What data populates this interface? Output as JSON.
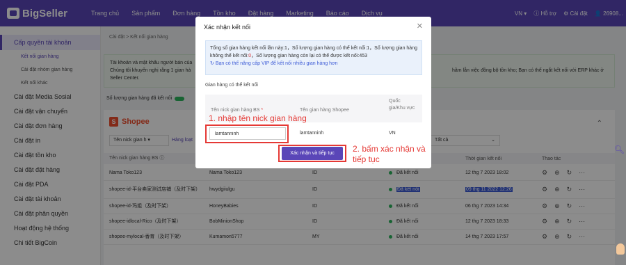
{
  "header": {
    "logo": "BigSeller",
    "nav": [
      "Trang chủ",
      "Sản phẩm",
      "Đơn hàng",
      "Tồn kho",
      "Đặt hàng",
      "Marketing",
      "Báo cáo",
      "Dịch vụ"
    ],
    "region": "VN",
    "help": "Hỗ trợ",
    "settings": "Cài đặt",
    "user": "26908..."
  },
  "sidebar": {
    "active": "Cấp quyền tài khoản",
    "subs": [
      "Kết nối gian hàng",
      "Cài đặt nhóm gian hàng",
      "Kết nối khác"
    ],
    "items": [
      "Cài đặt Media Sosial",
      "Cài đặt vận chuyển",
      "Cài đặt đơn hàng",
      "Cài đặt in",
      "Cài đặt tồn kho",
      "Cài đặt đặt hàng",
      "Cài đặt PDA",
      "Cài đặt tài khoản",
      "Cài đặt phân quyền",
      "Hoạt động hệ thống",
      "Chi tiết BigCoin"
    ]
  },
  "main": {
    "breadcrumb": "Cài đặt  >  Kết nối gian hàng",
    "notice_line1": "Tài khoản và mật khẩu người bán của",
    "notice_line2": "Chúng tôi khuyến nghị rằng 1 gian hà",
    "notice_line3": "Seller Center.",
    "notice_right": "hầm lẫn việc đồng bộ tồn kho; Bạn có thể ngắt kết nối với ERP khác ở",
    "connected_count": "Số lượng gian hàng đã kết nối",
    "platform": "Shopee",
    "filter_nick": "Tên nick gian h",
    "filter_loat": "Hàng loạt",
    "filter_all": "Tất cả",
    "table_headers": [
      "Tên nick gian hàng BS ⓘ",
      "",
      "",
      "",
      "Thời gian kết nối",
      "Thao tác"
    ],
    "rows": [
      {
        "nick": "Nama Toko123",
        "shop": "Nama Toko123",
        "country": "ID",
        "status": "Đã kết nối",
        "time": "12 thg 7 2023 18:02"
      },
      {
        "nick": "shopee-id-平台卖家测试店铺（及时下架）",
        "shop": "hwydgiiulgu",
        "country": "ID",
        "status": "Đã kết nối",
        "time": "09 thg 11 2022 12:26"
      },
      {
        "nick": "shopee-id-玛姐（及时下架）",
        "shop": "HoneyBabies",
        "country": "ID",
        "status": "Đã kết nối",
        "time": "06 thg 7 2023 14:34"
      },
      {
        "nick": "shopee-idlocal-Rico（及时下架）",
        "shop": "BobMinionShop",
        "country": "ID",
        "status": "Đã kết nối",
        "time": "12 thg 7 2023 18:33"
      },
      {
        "nick": "shopee-mylocal-香育（及时下架）",
        "shop": "Kumamon5777",
        "country": "MY",
        "status": "Đã kết nối",
        "time": "14 thg 7 2023 17:57"
      }
    ]
  },
  "modal": {
    "title": "Xác nhận kết nối",
    "info_a": "Tổng số gian hàng kết nối lần này:1，Số lượng gian hàng có thể kết nối:1，Số lượng",
    "info_b": "gian hàng không thể kết nối:",
    "info_zero": "0",
    "info_c": "，Số lượng gian hàng còn lại có thể được kết nối:453",
    "info_link": "Bạn có thể nâng cấp VIP để kết nối nhiều gian hàng hơn",
    "subtitle": "Gian hàng có thể kết nối",
    "col1": "Tên nick gian hàng BS",
    "col2": "Tên gian hàng Shopee",
    "col3": "Quốc gia/Khu vực",
    "input_value": "lamtanninh",
    "shop_name": "lamtanninh",
    "country": "VN",
    "confirm": "Xác nhận và tiếp tục"
  },
  "annotations": {
    "step1": "1. nhập tên nick gian hàng",
    "step2": "2. bấm xác nhận và tiếp tục"
  },
  "colors": {
    "brand": "#5a46b8",
    "annotation": "#e53935",
    "connected": "#2db55d"
  }
}
